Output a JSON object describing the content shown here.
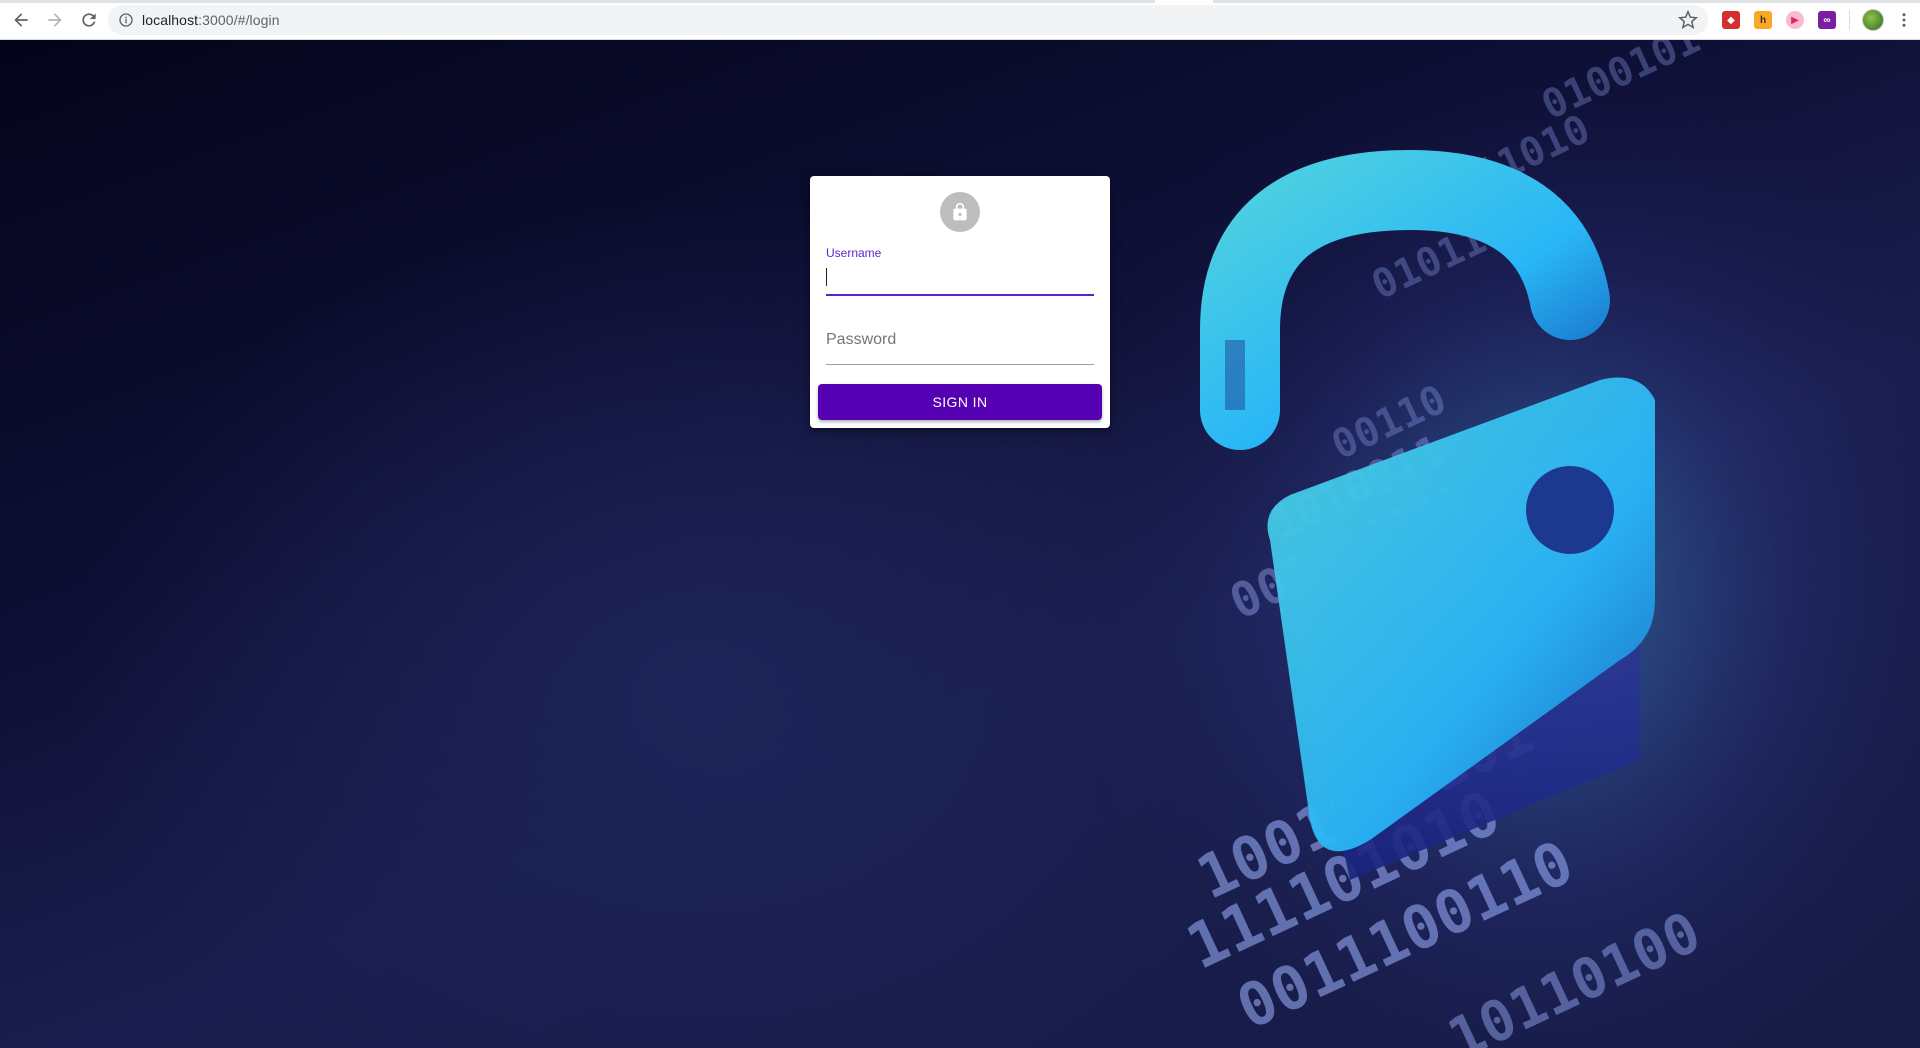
{
  "browser": {
    "url_host": "localhost",
    "url_path": ":3000/#/login",
    "icons": {
      "back": "arrow-left-icon",
      "forward": "arrow-right-icon",
      "reload": "reload-icon",
      "site_info": "info-icon",
      "bookmark": "star-icon",
      "menu": "kebab-menu-icon"
    },
    "extensions": [
      {
        "name": "extension-red-icon",
        "color": "#d32f2f",
        "glyph": "◆"
      },
      {
        "name": "extension-yellow-icon",
        "color": "#f9a825",
        "glyph": "h"
      },
      {
        "name": "extension-play-icon",
        "color": "#ec407a",
        "glyph": "▶"
      },
      {
        "name": "extension-purple-icon",
        "color": "#7b1fa2",
        "glyph": "∞"
      }
    ]
  },
  "login": {
    "avatar_icon": "lock-icon",
    "username_label": "Username",
    "username_value": "",
    "password_placeholder": "Password",
    "password_value": "",
    "signin_label": "SIGN IN"
  },
  "colors": {
    "primary": "#5c1fd6",
    "button": "#5600b4",
    "background_dark": "#0e0f35"
  }
}
